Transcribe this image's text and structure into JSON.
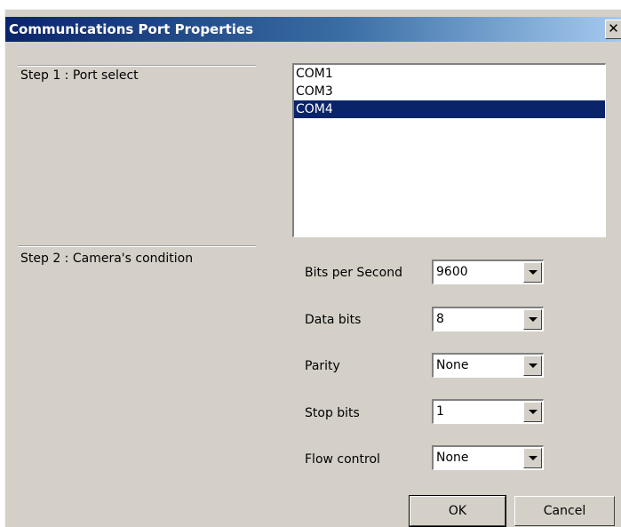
{
  "window": {
    "title": "Communications Port Properties",
    "close_glyph": "✕",
    "close_icon": "close-icon"
  },
  "step1": {
    "label": "Step 1 : Port select",
    "ports": [
      {
        "name": "COM1",
        "selected": false
      },
      {
        "name": "COM3",
        "selected": false
      },
      {
        "name": "COM4",
        "selected": true
      }
    ]
  },
  "step2": {
    "label": "Step 2 : Camera's condition",
    "fields": {
      "bits_per_second": {
        "label": "Bits per Second",
        "value": "9600"
      },
      "data_bits": {
        "label": "Data bits",
        "value": "8"
      },
      "parity": {
        "label": "Parity",
        "value": "None"
      },
      "stop_bits": {
        "label": "Stop bits",
        "value": "1"
      },
      "flow_control": {
        "label": "Flow control",
        "value": "None"
      }
    }
  },
  "buttons": {
    "ok": "OK",
    "cancel": "Cancel"
  },
  "colors": {
    "dialog_face": "#d4d0c8",
    "title_bar": "#0a246a",
    "selection": "#0a246a"
  }
}
